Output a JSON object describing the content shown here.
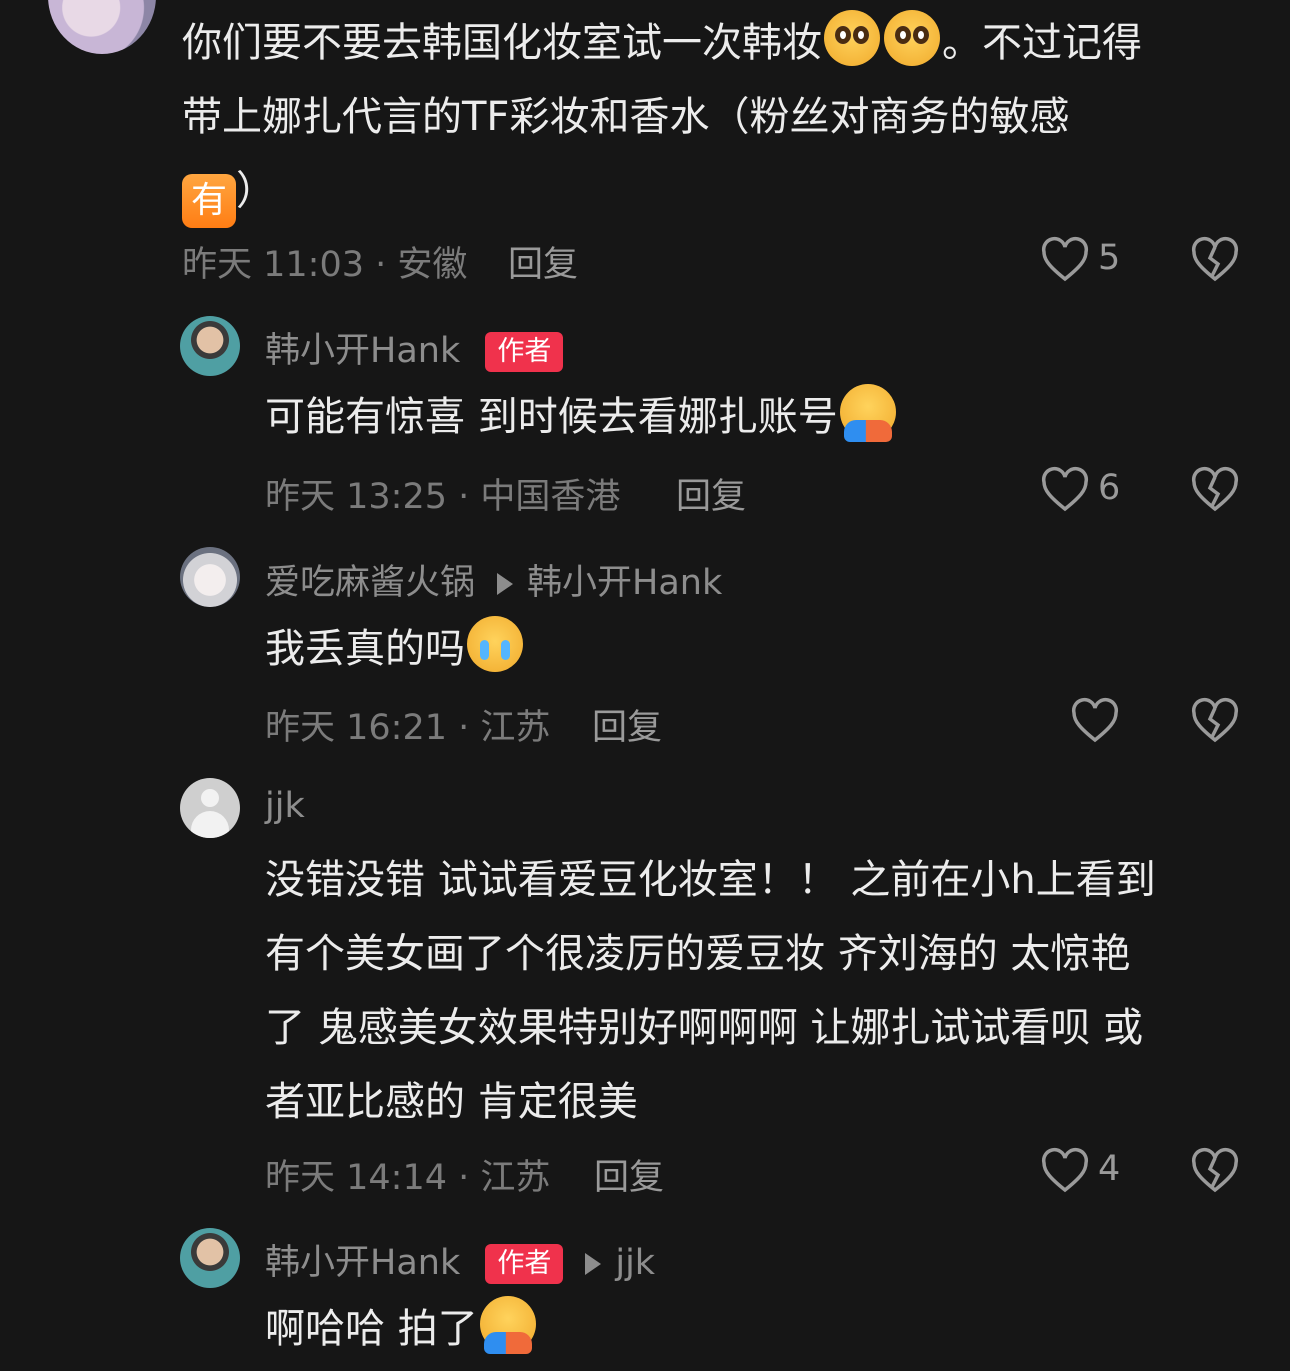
{
  "top_comment": {
    "lines": [
      "你们要不要去韩国化妆室试一次韩妆",
      "。不过记得",
      "带上娜扎代言的TF彩妆和香水（粉丝对商务的敏感",
      "有",
      "）"
    ],
    "time_location": "昨天 11:03 · 安徽",
    "reply_label": "回复",
    "likes": "5"
  },
  "reply1": {
    "author": "韩小开Hank",
    "badge": "作者",
    "text": "可能有惊喜 到时候去看娜扎账号",
    "time_location": "昨天 13:25 · 中国香港",
    "reply_label": "回复",
    "likes": "6"
  },
  "reply2": {
    "author": "爱吃麻酱火锅",
    "reply_to": "韩小开Hank",
    "text": "我丢真的吗",
    "time_location": "昨天 16:21 · 江苏",
    "reply_label": "回复"
  },
  "reply3": {
    "author": "jjk",
    "lines": [
      "没错没错 试试看爱豆化妆室！！ 之前在小h上看到",
      "有个美女画了个很凌厉的爱豆妆 齐刘海的 太惊艳",
      "了 鬼感美女效果特别好啊啊啊 让娜扎试试看呗 或",
      "者亚比感的 肯定很美"
    ],
    "time_location": "昨天 14:14 · 江苏",
    "reply_label": "回复",
    "likes": "4"
  },
  "reply4": {
    "author": "韩小开Hank",
    "badge": "作者",
    "reply_to": "jjk",
    "text": "啊哈哈 拍了"
  },
  "colors": {
    "background": "#161616",
    "author_badge": "#f0324c",
    "text": "#ececec",
    "meta": "#7b7b7b"
  }
}
